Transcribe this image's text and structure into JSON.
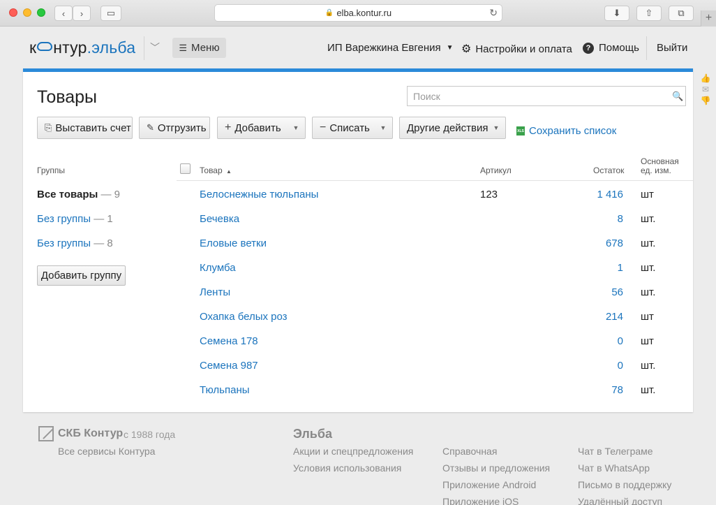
{
  "browser": {
    "url": "elba.kontur.ru"
  },
  "header": {
    "logo_part1": "к",
    "logo_part2": "нтур",
    "logo_dot": ".",
    "logo_brand": "эльба",
    "menu_label": "Меню",
    "account_label": "ИП Варежкина Евгения",
    "settings_label": "Настройки и оплата",
    "help_label": "Помощь",
    "logout_label": "Выйти"
  },
  "page": {
    "title": "Товары",
    "search_placeholder": "Поиск"
  },
  "toolbar": {
    "invoice_label": "Выставить счет",
    "ship_label": "Отгрузить",
    "add_label": "Добавить",
    "writeoff_label": "Списать",
    "other_label": "Другие действия",
    "save_list_label": "Сохранить список",
    "xls_icon_text": "XLS"
  },
  "columns": {
    "groups": "Группы",
    "product": "Товар",
    "sku": "Артикул",
    "stock": "Остаток",
    "unit_line1": "Основная",
    "unit_line2": "ед. изм."
  },
  "groups": [
    {
      "name": "Все товары",
      "count": "— 9"
    },
    {
      "name": "Без группы",
      "count": "— 1"
    },
    {
      "name": "Без группы",
      "count": "— 8"
    }
  ],
  "add_group_label": "Добавить группу",
  "products": [
    {
      "name": "Белоснежные тюльпаны",
      "sku": "123",
      "qty": "1 416",
      "unit": "шт"
    },
    {
      "name": "Бечевка",
      "sku": "",
      "qty": "8",
      "unit": "шт."
    },
    {
      "name": "Еловые ветки",
      "sku": "",
      "qty": "678",
      "unit": "шт."
    },
    {
      "name": "Клумба",
      "sku": "",
      "qty": "1",
      "unit": "шт."
    },
    {
      "name": "Ленты",
      "sku": "",
      "qty": "56",
      "unit": "шт."
    },
    {
      "name": "Охапка белых роз",
      "sku": "",
      "qty": "214",
      "unit": "шт"
    },
    {
      "name": "Семена 178",
      "sku": "",
      "qty": "0",
      "unit": "шт"
    },
    {
      "name": "Семена 987",
      "sku": "",
      "qty": "0",
      "unit": "шт."
    },
    {
      "name": "Тюльпаны",
      "sku": "",
      "qty": "78",
      "unit": "шт."
    }
  ],
  "footer": {
    "company": "СКБ Контур",
    "since": "с 1988 года",
    "all_services": "Все сервисы Контура",
    "elba_heading": "Эльба",
    "col1": [
      "Акции и спецпредложения",
      "Условия использования"
    ],
    "col2": [
      "Справочная",
      "Отзывы и предложения",
      "Приложение Android",
      "Приложение iOS"
    ],
    "col3": [
      "Чат в Телеграме",
      "Чат в WhatsApp",
      "Письмо в поддержку",
      "Удалённый доступ"
    ]
  }
}
